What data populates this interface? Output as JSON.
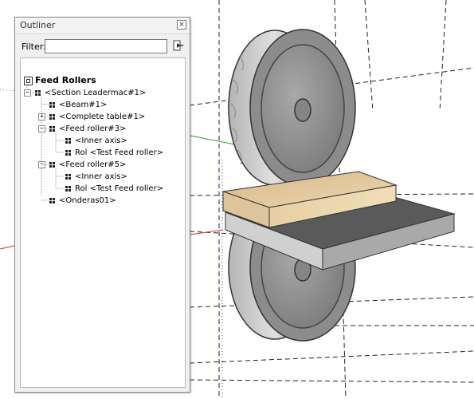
{
  "outliner": {
    "title": "Outliner",
    "close_glyph": "×",
    "filter": {
      "label": "Filter:",
      "value": "",
      "placeholder": ""
    },
    "tree": {
      "model_name": "Feed Rollers",
      "items": [
        {
          "label": "<Section Leadermac#1>",
          "expander": "−"
        },
        {
          "label": "<Beam#1>",
          "expander": ""
        },
        {
          "label": "<Complete table#1>",
          "expander": "+"
        },
        {
          "label": "<Feed roller#3>",
          "expander": "−"
        },
        {
          "label": "<Inner axis>",
          "expander": ""
        },
        {
          "label": "Rol <Test Feed roller>",
          "expander": ""
        },
        {
          "label": "<Feed roller#5>",
          "expander": "−"
        },
        {
          "label": "<Inner axis>",
          "expander": ""
        },
        {
          "label": "Rol <Test Feed roller>",
          "expander": ""
        },
        {
          "label": "<Onderas01>",
          "expander": ""
        }
      ]
    }
  },
  "colors": {
    "axis_red": "#d03030",
    "axis_green": "#2fa02f",
    "roller_gray": "#8c8c8c",
    "wood": "#e6cfa6",
    "table": "#5a5a5a"
  }
}
